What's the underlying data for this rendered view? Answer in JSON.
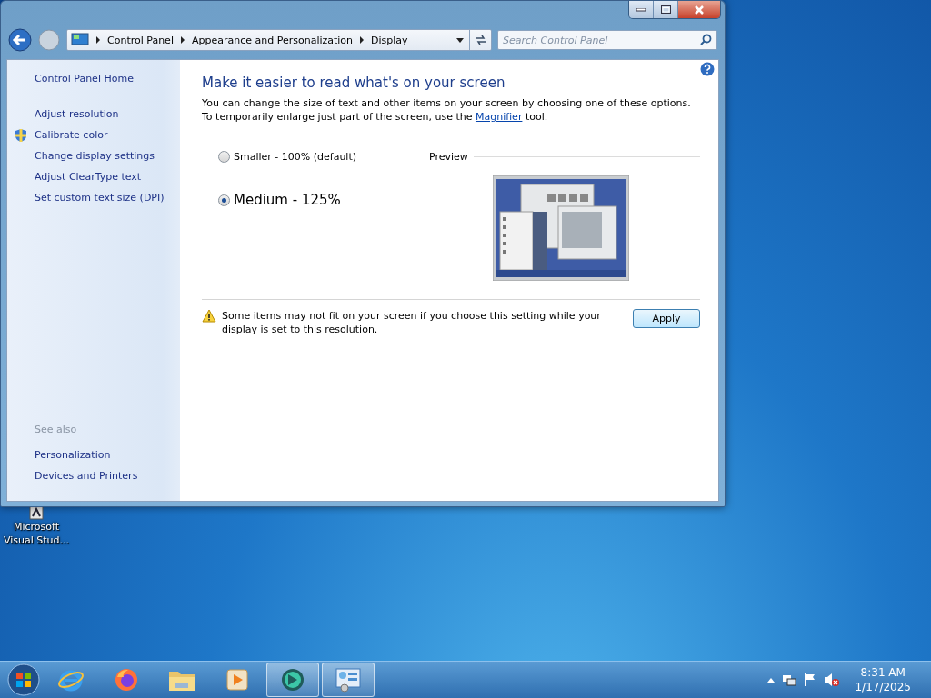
{
  "window": {
    "breadcrumbs": [
      "Control Panel",
      "Appearance and Personalization",
      "Display"
    ],
    "search": {
      "placeholder": "Search Control Panel"
    }
  },
  "sidebar": {
    "home": "Control Panel Home",
    "tasks": [
      {
        "label": "Adjust resolution",
        "kind": "plain"
      },
      {
        "label": "Calibrate color",
        "kind": "shield"
      },
      {
        "label": "Change display settings",
        "kind": "plain"
      },
      {
        "label": "Adjust ClearType text",
        "kind": "plain"
      },
      {
        "label": "Set custom text size (DPI)",
        "kind": "plain"
      }
    ],
    "see_also_heading": "See also",
    "see_also": [
      "Personalization",
      "Devices and Printers"
    ]
  },
  "content": {
    "title": "Make it easier to read what's on your screen",
    "description_before": "You can change the size of text and other items on your screen by choosing one of these options. To temporarily enlarge just part of the screen, use the",
    "description_link": "Magnifier",
    "description_after": "tool.",
    "options": [
      {
        "label": "Smaller - 100% (default)",
        "selected": false,
        "kind": "small"
      },
      {
        "label": "Medium - 125%",
        "selected": true,
        "kind": "large"
      }
    ],
    "preview_label": "Preview",
    "warning": "Some items may not fit on your screen if you choose this setting while your display is set to this resolution.",
    "apply_button": "Apply"
  },
  "desktop_icons": [
    {
      "label": "Microsoft Visual Stud..."
    }
  ],
  "taskbar": {
    "items": [
      {
        "kind": "ie",
        "highlighted": false
      },
      {
        "kind": "firefox",
        "highlighted": false
      },
      {
        "kind": "folder",
        "highlighted": false
      },
      {
        "kind": "media",
        "highlighted": false
      },
      {
        "kind": "app",
        "highlighted": true
      },
      {
        "kind": "control-panel",
        "highlighted": true
      }
    ],
    "time": "8:31 AM",
    "date": "1/17/2025"
  }
}
